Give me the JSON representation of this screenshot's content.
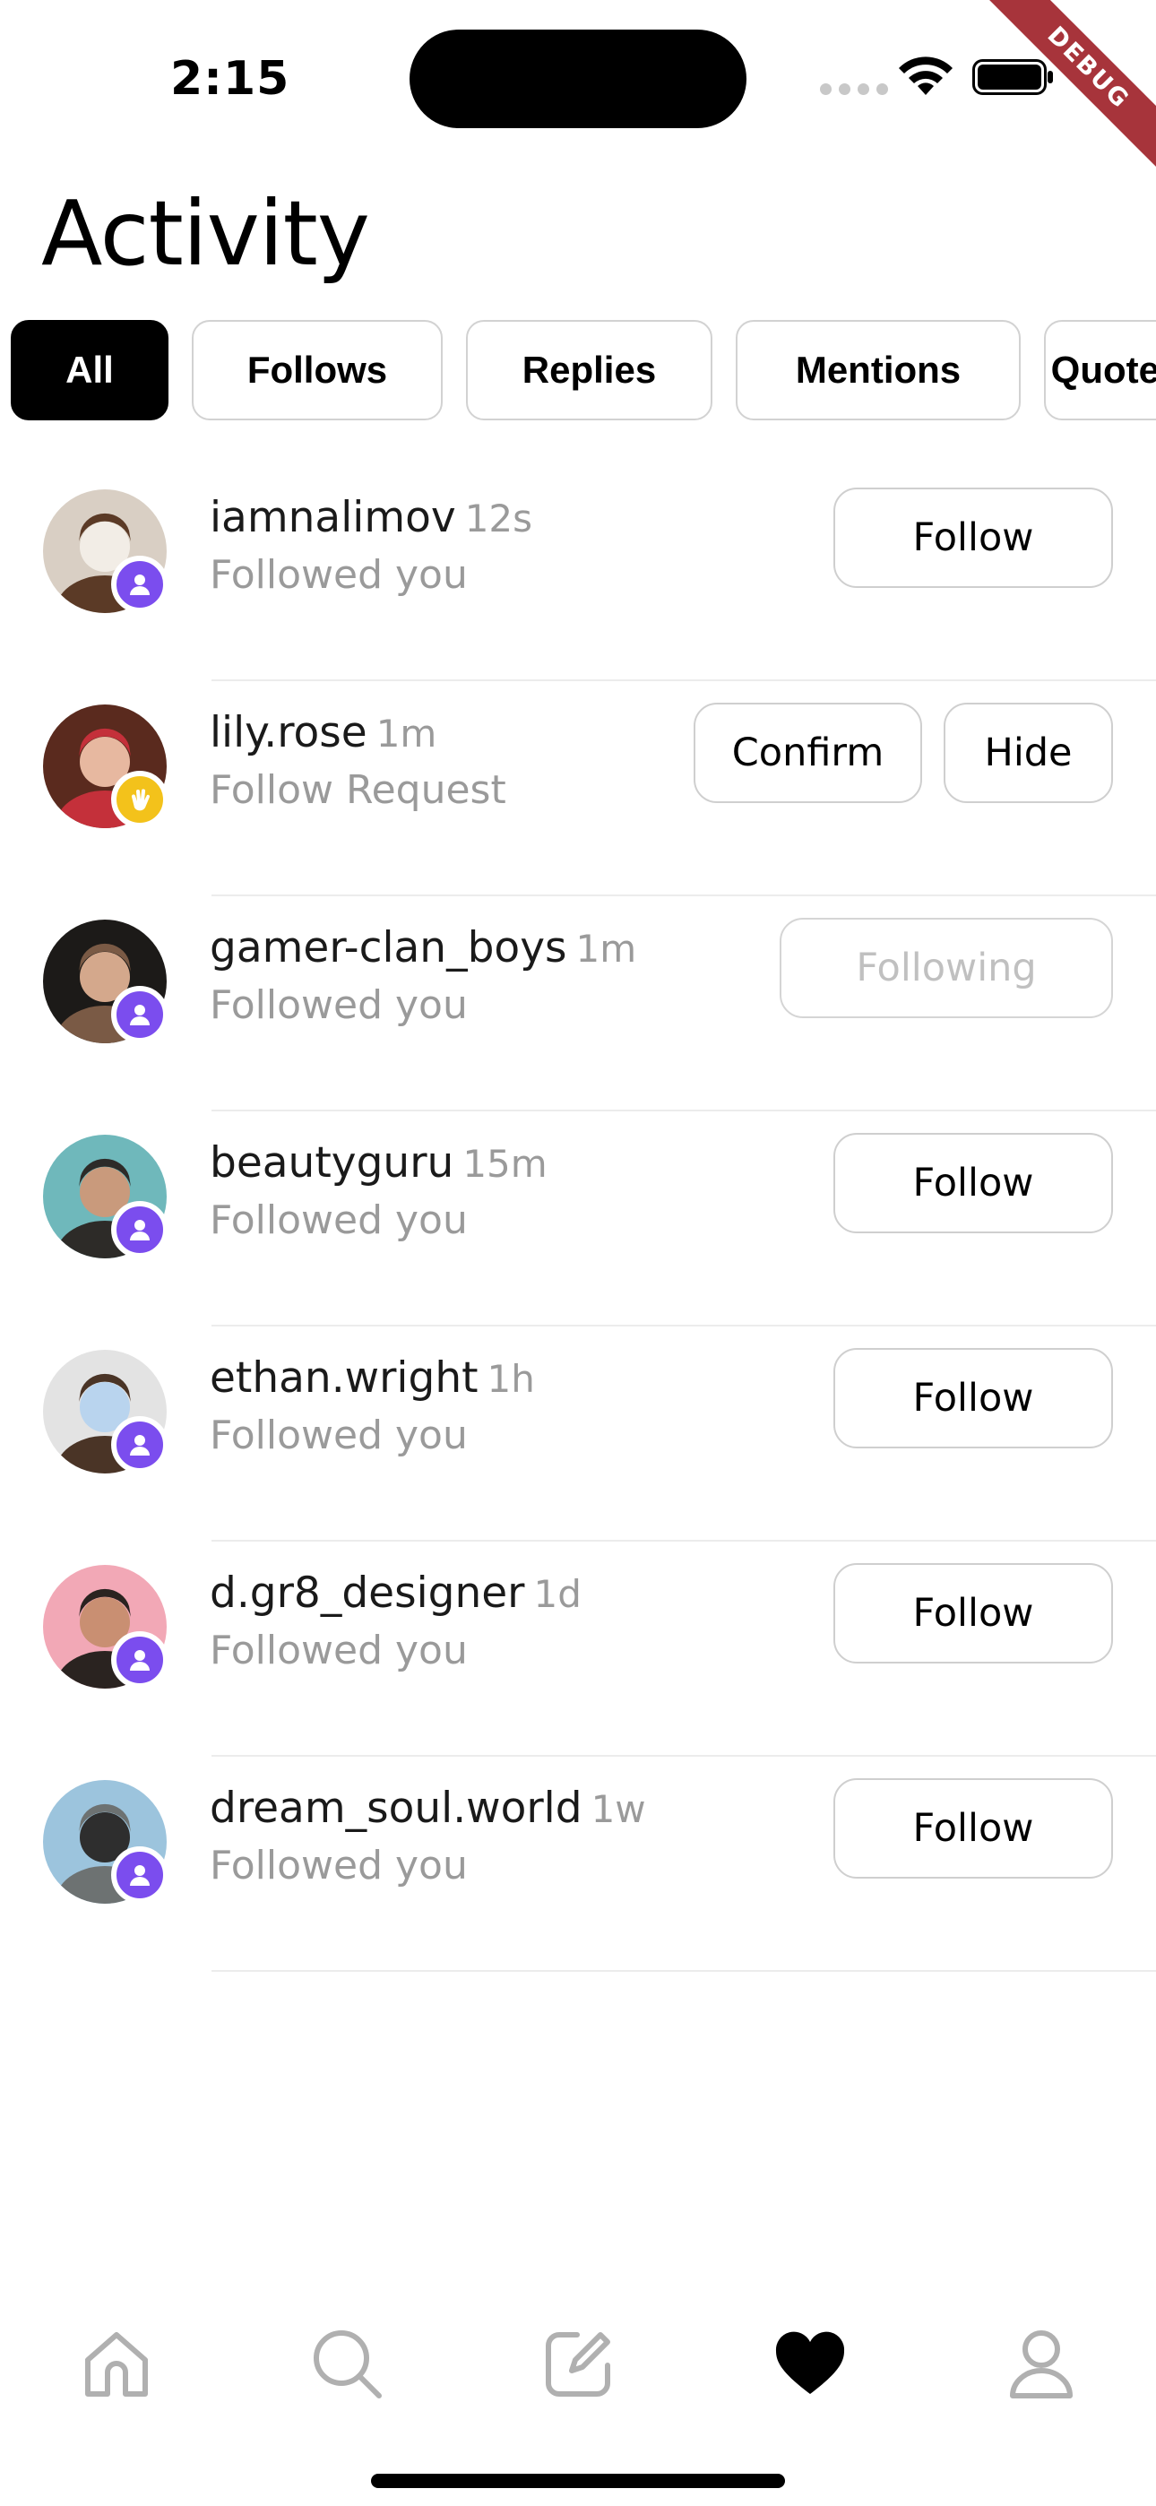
{
  "status_bar": {
    "time": "2:15",
    "debug_label": "DEBUG"
  },
  "title": "Activity",
  "filters": [
    {
      "label": "All",
      "active": true
    },
    {
      "label": "Follows",
      "active": false
    },
    {
      "label": "Replies",
      "active": false
    },
    {
      "label": "Mentions",
      "active": false
    },
    {
      "label": "Quotes",
      "active": false
    }
  ],
  "activity": [
    {
      "username": "iamnalimov",
      "time": "12s",
      "subtext": "Followed you",
      "badge": "person-icon",
      "avatar_colors": [
        "#d9cfc4",
        "#5b3a26",
        "#f2ede6"
      ],
      "action": "follow",
      "button": "Follow"
    },
    {
      "username": "lily.rose",
      "time": "1m",
      "subtext": "Follow Request",
      "badge": "wave-hand-icon",
      "avatar_colors": [
        "#5a2a1e",
        "#c4303a",
        "#e7b8a0"
      ],
      "action": "request",
      "confirm": "Confirm",
      "hide": "Hide"
    },
    {
      "username": "gamer-clan_boys",
      "time": "1m",
      "subtext": "Followed you",
      "badge": "person-icon",
      "avatar_colors": [
        "#1c1a18",
        "#7a5a45",
        "#d4a88c"
      ],
      "action": "following",
      "button": "Following"
    },
    {
      "username": "beautyguru",
      "time": "15m",
      "subtext": "Followed you",
      "badge": "person-icon",
      "avatar_colors": [
        "#6fb8bb",
        "#2d2b28",
        "#c99a7c"
      ],
      "action": "follow",
      "button": "Follow"
    },
    {
      "username": "ethan.wright",
      "time": "1h",
      "subtext": "Followed you",
      "badge": "person-icon",
      "avatar_colors": [
        "#e3e3e3",
        "#4a3426",
        "#b9d4ee"
      ],
      "action": "follow",
      "button": "Follow"
    },
    {
      "username": "d.gr8_designer",
      "time": "1d",
      "subtext": "Followed you",
      "badge": "person-icon",
      "avatar_colors": [
        "#f2a8b6",
        "#2a2320",
        "#c98f72"
      ],
      "action": "follow",
      "button": "Follow"
    },
    {
      "username": "dream_soul.world",
      "time": "1w",
      "subtext": "Followed you",
      "badge": "person-icon",
      "avatar_colors": [
        "#9cc4dd",
        "#6d7272",
        "#2e2e2e"
      ],
      "action": "follow",
      "button": "Follow"
    }
  ],
  "tab_bar": [
    {
      "icon": "home-icon",
      "active": false
    },
    {
      "icon": "search-icon",
      "active": false
    },
    {
      "icon": "compose-icon",
      "active": false
    },
    {
      "icon": "heart-icon",
      "active": true
    },
    {
      "icon": "profile-icon",
      "active": false
    }
  ],
  "colors": {
    "badge_follow": "#7b4dee",
    "badge_request": "#f3c21b",
    "debug_ribbon": "#a7343b"
  }
}
